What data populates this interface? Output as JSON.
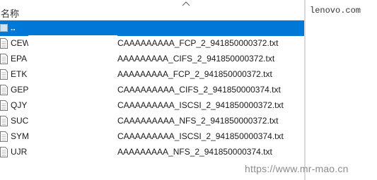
{
  "file_list": {
    "column_name": "名称",
    "parent_entry": "..",
    "rows": [
      {
        "short": "CEW",
        "full": "CAAAAAAAAA_FCP_2_941850000372.txt"
      },
      {
        "short": "EPA",
        "full": "AAAAAAAAA_CIFS_2_941850000372.txt"
      },
      {
        "short": "ETK",
        "full": "AAAAAAAAA_FCP_2_941850000372.txt"
      },
      {
        "short": "GEP",
        "full": "CAAAAAAAAA_CIFS_2_941850000374.txt"
      },
      {
        "short": "QJY",
        "full": "CAAAAAAAAA_ISCSI_2_941850000372.txt"
      },
      {
        "short": "SUC",
        "full": "CAAAAAAAAA_NFS_2_941850000372.txt"
      },
      {
        "short": "SYM",
        "full": "CAAAAAAAAA_ISCSI_2_941850000374.txt"
      },
      {
        "short": "UJR",
        "full": "AAAAAAAAA_NFS_2_941850000374.txt"
      }
    ]
  },
  "preview": {
    "text": "lenovo.com"
  },
  "watermark": "https://www.mr-mao.cn",
  "colors": {
    "selection": "#0078d7",
    "divider": "#d9d9d9"
  },
  "icons": {
    "sort": "chevron-up-icon",
    "file": "text-file-icon",
    "folder": "folder-icon"
  }
}
